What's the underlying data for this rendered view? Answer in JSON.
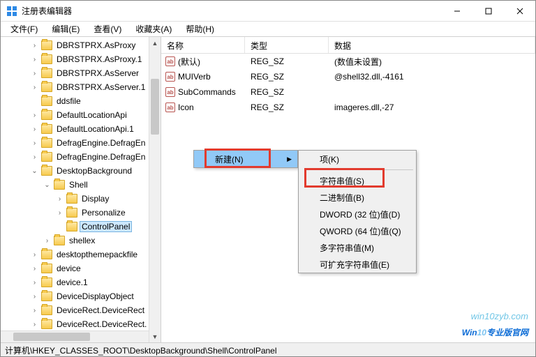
{
  "window": {
    "title": "注册表编辑器"
  },
  "menu": {
    "file": "文件(F)",
    "edit": "编辑(E)",
    "view": "查看(V)",
    "fav": "收藏夹(A)",
    "help": "帮助(H)"
  },
  "tree": [
    {
      "d": 1,
      "e": ">",
      "t": "DBRSTPRX.AsProxy"
    },
    {
      "d": 1,
      "e": ">",
      "t": "DBRSTPRX.AsProxy.1"
    },
    {
      "d": 1,
      "e": ">",
      "t": "DBRSTPRX.AsServer"
    },
    {
      "d": 1,
      "e": ">",
      "t": "DBRSTPRX.AsServer.1"
    },
    {
      "d": 1,
      "e": "",
      "t": "ddsfile"
    },
    {
      "d": 1,
      "e": ">",
      "t": "DefaultLocationApi"
    },
    {
      "d": 1,
      "e": ">",
      "t": "DefaultLocationApi.1"
    },
    {
      "d": 1,
      "e": ">",
      "t": "DefragEngine.DefragEn"
    },
    {
      "d": 1,
      "e": ">",
      "t": "DefragEngine.DefragEn"
    },
    {
      "d": 1,
      "e": "v",
      "t": "DesktopBackground"
    },
    {
      "d": 2,
      "e": "v",
      "t": "Shell"
    },
    {
      "d": 3,
      "e": ">",
      "t": "Display"
    },
    {
      "d": 3,
      "e": ">",
      "t": "Personalize"
    },
    {
      "d": 3,
      "e": "",
      "t": "ControlPanel",
      "sel": true
    },
    {
      "d": 2,
      "e": ">",
      "t": "shellex"
    },
    {
      "d": 1,
      "e": ">",
      "t": "desktopthemepackfile"
    },
    {
      "d": 1,
      "e": ">",
      "t": "device"
    },
    {
      "d": 1,
      "e": ">",
      "t": "device.1"
    },
    {
      "d": 1,
      "e": ">",
      "t": "DeviceDisplayObject"
    },
    {
      "d": 1,
      "e": ">",
      "t": "DeviceRect.DeviceRect"
    },
    {
      "d": 1,
      "e": ">",
      "t": "DeviceRect.DeviceRect."
    }
  ],
  "columns": {
    "name": "名称",
    "type": "类型",
    "data": "数据"
  },
  "rows": [
    {
      "name": "(默认)",
      "type": "REG_SZ",
      "data": "(数值未设置)"
    },
    {
      "name": "MUIVerb",
      "type": "REG_SZ",
      "data": "@shell32.dll,-4161"
    },
    {
      "name": "SubCommands",
      "type": "REG_SZ",
      "data": ""
    },
    {
      "name": "Icon",
      "type": "REG_SZ",
      "data": "imageres.dll,-27"
    }
  ],
  "context1": {
    "new": "新建(N)"
  },
  "context2": {
    "key": "项(K)",
    "string": "字符串值(S)",
    "binary": "二进制值(B)",
    "dword": "DWORD (32 位)值(D)",
    "qword": "QWORD (64 位)值(Q)",
    "multi": "多字符串值(M)",
    "expand": "可扩充字符串值(E)"
  },
  "status": "计算机\\HKEY_CLASSES_ROOT\\DesktopBackground\\Shell\\ControlPanel",
  "watermark": {
    "url": "win10zyb.com",
    "brand1": "Win",
    "brand2": "10",
    "brand3": "专业版官网"
  }
}
